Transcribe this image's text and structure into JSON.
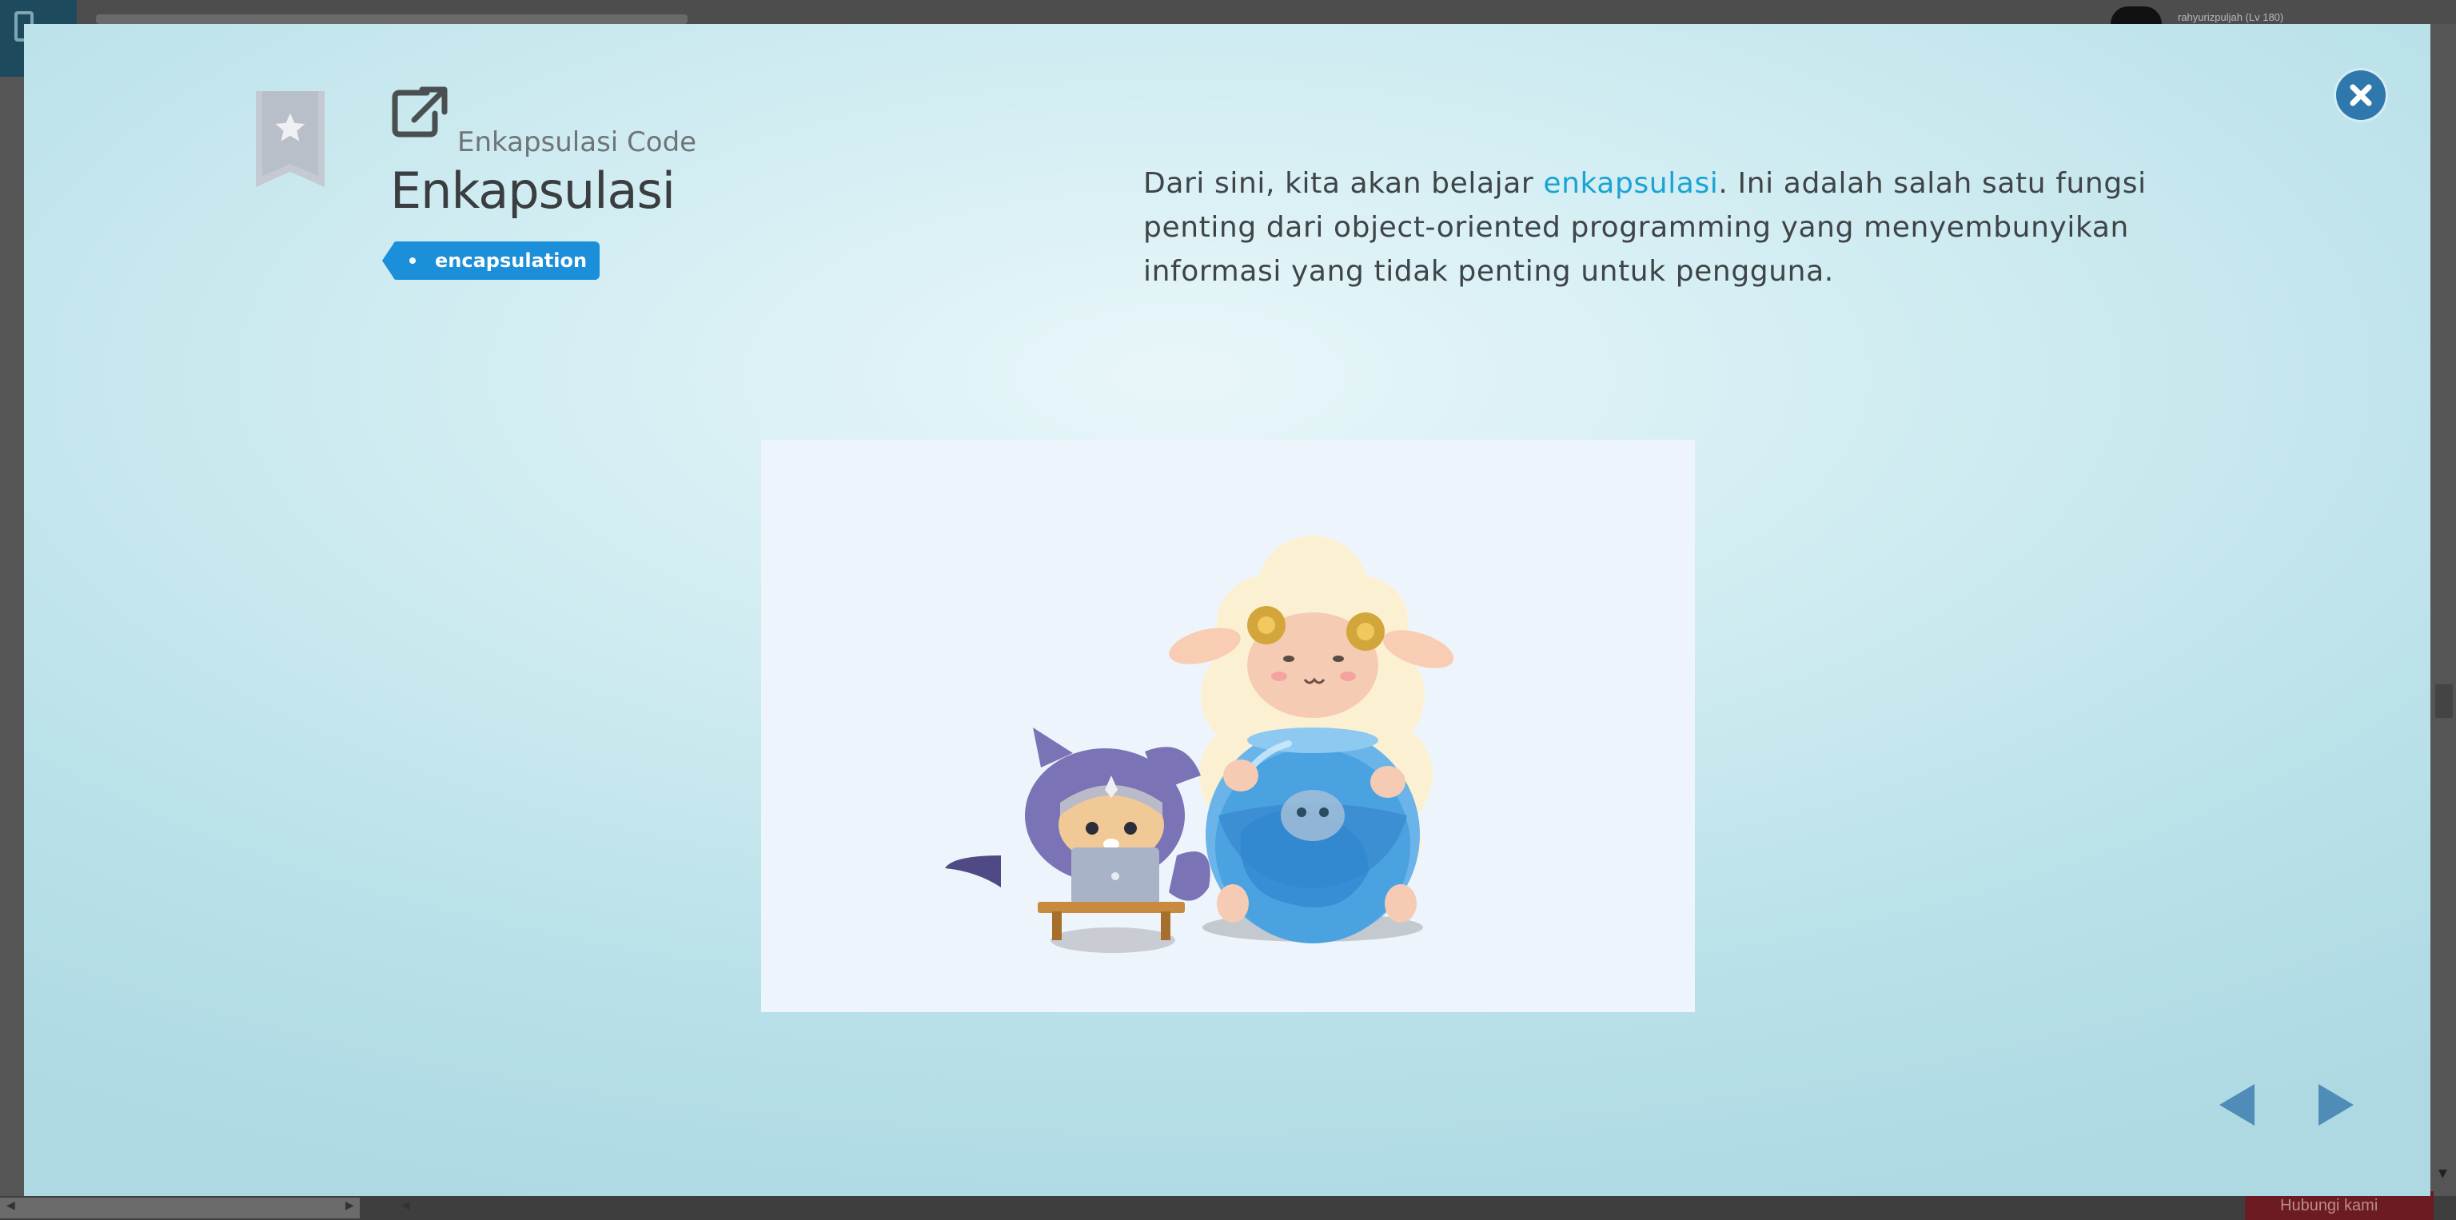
{
  "background": {
    "username": "rahyurizpuljah (Lv 180)",
    "bottom_button_label": "Hubungi kami"
  },
  "modal": {
    "subtitle": "Enkapsulasi Code",
    "title": "Enkapsulasi",
    "tag": "encapsulation",
    "description": {
      "before": "Dari sini, kita akan belajar ",
      "highlight": "enkapsulasi",
      "after": ". Ini adalah salah satu fungsi penting dari object-oriented programming yang menyembunyikan informasi yang tidak penting untuk pengguna."
    },
    "icons": {
      "bookmark": "bookmark-star-icon",
      "external": "external-link-icon",
      "close": "close-icon",
      "prev": "arrow-left-icon",
      "next": "arrow-right-icon"
    },
    "colors": {
      "accent": "#1aa3d4",
      "tag": "#1b8fd9",
      "close": "#2f78ae",
      "nav": "#4f8cb8"
    }
  }
}
